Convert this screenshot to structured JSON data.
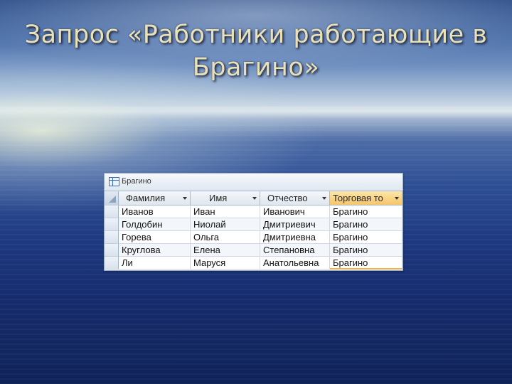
{
  "slide": {
    "title": "Запрос «Работники работающие в Брагино»"
  },
  "window": {
    "tab_label": "Брагино",
    "columns": [
      "Фамилия",
      "Имя",
      "Отчество",
      "Торговая то"
    ],
    "rows": [
      [
        "Иванов",
        "Иван",
        "Иванович",
        "Брагино"
      ],
      [
        "Голдобин",
        "Ниолай",
        "Дмитриевич",
        "Брагино"
      ],
      [
        "Горева",
        "Ольга",
        "Дмитриевна",
        "Брагино"
      ],
      [
        "Круглова",
        "Елена",
        "Степановна",
        "Брагино"
      ],
      [
        "Ли",
        "Маруся",
        "Анатольевна",
        "Брагино"
      ]
    ],
    "active_column_color": "#f6c56a"
  }
}
